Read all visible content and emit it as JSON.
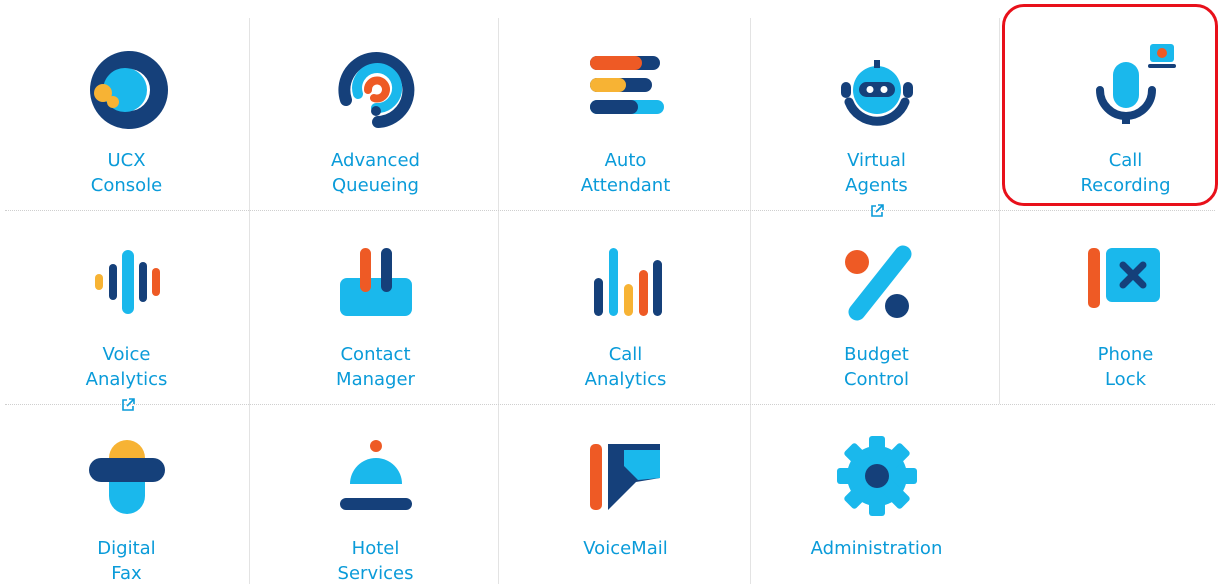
{
  "colors": {
    "label": "#0a9bd9",
    "navy": "#15407a",
    "cyan": "#1ab8ec",
    "orange": "#ee5a25",
    "yellow": "#f7b334",
    "highlight": "#e8101a"
  },
  "tiles": [
    {
      "icon": "ucx-console-icon",
      "line1": "UCX",
      "line2": "Console",
      "external": false
    },
    {
      "icon": "advanced-queueing-icon",
      "line1": "Advanced",
      "line2": "Queueing",
      "external": false
    },
    {
      "icon": "auto-attendant-icon",
      "line1": "Auto",
      "line2": "Attendant",
      "external": false
    },
    {
      "icon": "virtual-agents-icon",
      "line1": "Virtual",
      "line2": "Agents",
      "external": true
    },
    {
      "icon": "call-recording-icon",
      "line1": "Call",
      "line2": "Recording",
      "external": false,
      "highlighted": true
    },
    {
      "icon": "voice-analytics-icon",
      "line1": "Voice",
      "line2": "Analytics",
      "external": true
    },
    {
      "icon": "contact-manager-icon",
      "line1": "Contact",
      "line2": "Manager",
      "external": false
    },
    {
      "icon": "call-analytics-icon",
      "line1": "Call",
      "line2": "Analytics",
      "external": false
    },
    {
      "icon": "budget-control-icon",
      "line1": "Budget",
      "line2": "Control",
      "external": false
    },
    {
      "icon": "phone-lock-icon",
      "line1": "Phone",
      "line2": "Lock",
      "external": false
    },
    {
      "icon": "digital-fax-icon",
      "line1": "Digital",
      "line2": "Fax",
      "external": false
    },
    {
      "icon": "hotel-services-icon",
      "line1": "Hotel",
      "line2": "Services",
      "external": false
    },
    {
      "icon": "voicemail-icon",
      "line1": "VoiceMail",
      "line2": "",
      "external": false
    },
    {
      "icon": "administration-icon",
      "line1": "Administration",
      "line2": "",
      "external": false
    }
  ]
}
